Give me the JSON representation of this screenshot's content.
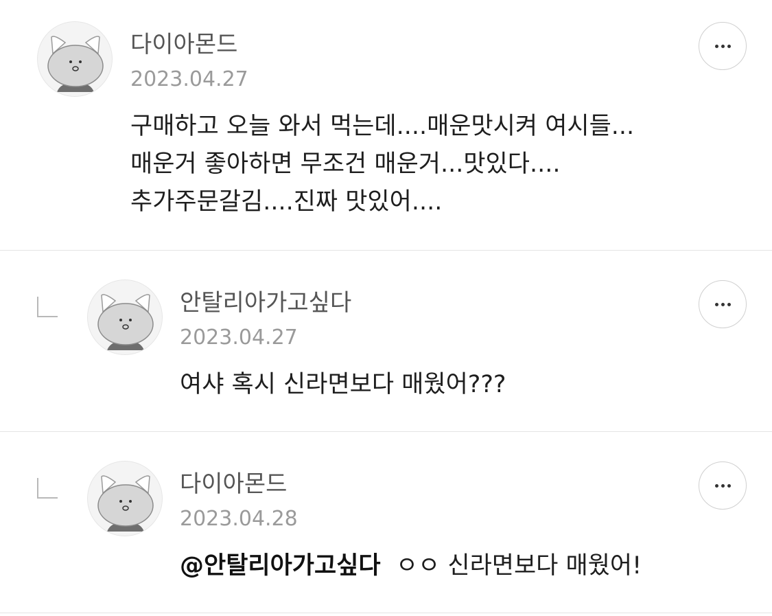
{
  "comments": [
    {
      "author": "다이아몬드",
      "date": "2023.04.27",
      "body": "구매하고 오늘 와서 먹는데....매운맛시켜 여시들...\n매운거 좋아하면 무조건 매운거...맛있다....\n추가주문갈김....진짜 맛있어....",
      "is_reply": false,
      "avatar_icon": "cat-avatar-icon",
      "more_icon": "more-options-icon"
    },
    {
      "author": "안탈리아가고싶다",
      "date": "2023.04.27",
      "body": "여샤 혹시 신라면보다 매웠어???",
      "is_reply": true,
      "avatar_icon": "cat-avatar-icon",
      "more_icon": "more-options-icon"
    },
    {
      "author": "다이아몬드",
      "date": "2023.04.28",
      "mention": "@안탈리아가고싶다",
      "body": "  ㅇㅇ 신라면보다 매웠어!",
      "is_reply": true,
      "avatar_icon": "cat-avatar-icon",
      "more_icon": "more-options-icon"
    }
  ],
  "colors": {
    "divider": "#e4e4e4",
    "author": "#555555",
    "date": "#9a9a9a",
    "body": "#1e1e1e",
    "avatar_bg": "#f4f4f4"
  }
}
